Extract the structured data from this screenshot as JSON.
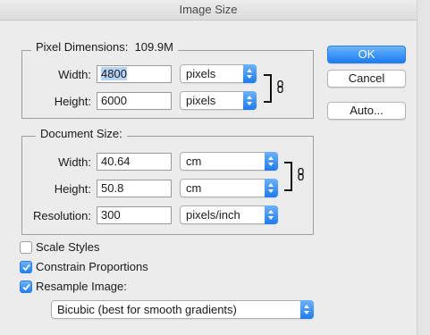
{
  "title": "Image Size",
  "pixel_dimensions": {
    "legend": "Pixel Dimensions:",
    "size": "109.9M",
    "width_label": "Width:",
    "width_value": "4800",
    "width_unit": "pixels",
    "height_label": "Height:",
    "height_value": "6000",
    "height_unit": "pixels"
  },
  "document_size": {
    "legend": "Document Size:",
    "width_label": "Width:",
    "width_value": "40.64",
    "width_unit": "cm",
    "height_label": "Height:",
    "height_value": "50.8",
    "height_unit": "cm",
    "resolution_label": "Resolution:",
    "resolution_value": "300",
    "resolution_unit": "pixels/inch"
  },
  "buttons": {
    "ok": "OK",
    "cancel": "Cancel",
    "auto": "Auto..."
  },
  "options": {
    "scale_styles": {
      "label": "Scale Styles",
      "checked": false
    },
    "constrain_proportions": {
      "label": "Constrain Proportions",
      "checked": true
    },
    "resample_image": {
      "label": "Resample Image:",
      "checked": true
    },
    "resample_method": "Bicubic (best for smooth gradients)"
  },
  "colors": {
    "accent": "#1a7df5",
    "highlight": "#b4d3f7",
    "dialog_bg": "#ececec"
  },
  "icons": {
    "link": "chain-link-icon",
    "popup_arrow": "up-down-arrows-icon",
    "check": "checkmark-icon"
  }
}
